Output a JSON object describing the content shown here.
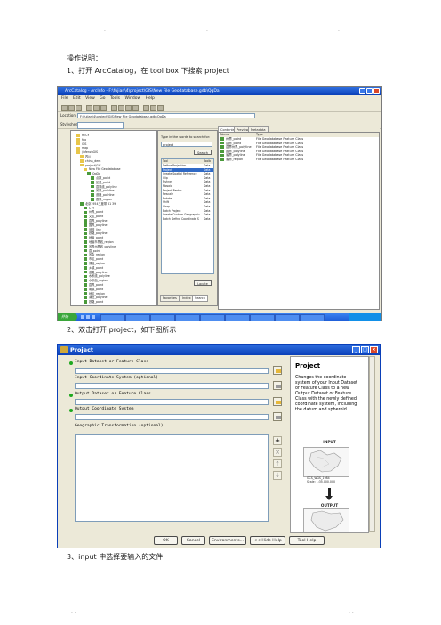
{
  "doc": {
    "header_marks": [
      ".",
      ".",
      "."
    ],
    "footer_marks": [
      ". .",
      ". ."
    ],
    "heading": "操作说明：",
    "step1": "1、打开 ArcCatalog，在 tool box 下搜索 project",
    "step2": "2、双击打开 project，如下图所示",
    "step3": "3、input 中选择要输入的文件"
  },
  "arccatalog": {
    "title": "ArcCatalog - ArcInfo - F:\\fujian\\4\\project\\GIS\\New File Geodatabase.gdb\\QgDa",
    "menu": [
      "File",
      "Edit",
      "View",
      "Go",
      "Tools",
      "Window",
      "Help"
    ],
    "location_label": "Location:",
    "location_value": "F:\\fujian\\4\\project\\GIS\\New File Geodatabase.gdb\\QgDa",
    "stylesheet_label": "Stylesheet:",
    "tree": [
      "RECY",
      "foo",
      "GIS",
      "map",
      "jiufenzhGIS",
      "四川",
      "china_dem",
      "project\\GIS",
      "New File Geodatabase",
      "QgDa",
      "点数_point",
      "区县_point",
      "县界线_polyline",
      "省界_polyline",
      "道路_polyline",
      "县界_region",
      "北京1954三度带 81 39",
      "CTY",
      "州界_point",
      "文区_point",
      "县界_polyline",
      "国界_polyline",
      "河流_line",
      "铁路_polyline",
      "地级_point",
      "地级市界线_region",
      "省界州界线_polyline",
      "县_point",
      "省会_region",
      "市区_point",
      "湖泊_region",
      "乡镇_point",
      "道路_polyline",
      "水系线_polyline",
      "水系面_region",
      "县界_point",
      "城镇_point",
      "地区_region",
      "湖泊_polyline",
      "铁路_point"
    ],
    "search_prompt": "Type in the words to search for:",
    "search_value": "project",
    "search_button": "Search",
    "tool_header": [
      "Tool",
      "Toolb"
    ],
    "tools": [
      [
        "Define Projection",
        "Data"
      ],
      [
        "Project",
        "Data"
      ],
      [
        "Create Spatial Reference",
        "Data"
      ],
      [
        "Clip",
        "Data"
      ],
      [
        "Fishnet",
        "Data"
      ],
      [
        "Mosaic",
        "Data"
      ],
      [
        "Project Raster",
        "Data"
      ],
      [
        "Rescale",
        "Data"
      ],
      [
        "Rotate",
        "Data"
      ],
      [
        "Shift",
        "Data"
      ],
      [
        "Warp",
        "Data"
      ],
      [
        "Batch Project",
        "Data"
      ],
      [
        "Create Custom Geographic",
        "Data"
      ],
      [
        "Batch Define Coordinate S",
        "Data"
      ]
    ],
    "locate_button": "Locate",
    "bottom_tabs": [
      "Favorites",
      "Index",
      "Search"
    ],
    "content_tabs": [
      "Contents",
      "Preview",
      "Metadata"
    ],
    "content_header": [
      "Name",
      "Type"
    ],
    "contents": [
      [
        "州界_point",
        "File Geodatabase Feature Class"
      ],
      [
        "县界_point",
        "File Geodatabase Feature Class"
      ],
      [
        "县界州界_polyline",
        "File Geodatabase Feature Class"
      ],
      [
        "国界_polyline",
        "File Geodatabase Feature Class"
      ],
      [
        "省界_polyline",
        "File Geodatabase Feature Class"
      ],
      [
        "省界_region",
        "File Geodatabase Feature Class"
      ]
    ],
    "start_label": "开始"
  },
  "project_dialog": {
    "title": "Project",
    "labels": {
      "input": "Input Dataset or Feature Class",
      "input_cs": "Input Coordinate System (optional)",
      "output": "Output Dataset or Feature Class",
      "output_cs": "Output Coordinate System",
      "geo_transform": "Geographic Transformation (optional)"
    },
    "help": {
      "title": "Project",
      "body": "Changes the coordinate system of your Input Dataset or Feature Class to a new Output Dataset or Feature Class with the newly defined coordinate system, including the datum and spheroid.",
      "input_label": "INPUT",
      "input_caption_1": "GCS_WGS_1984",
      "input_caption_2": "Scale: 1:35,000,000",
      "output_label": "OUTPUT"
    },
    "buttons": [
      "OK",
      "Cancel",
      "Environments...",
      "<< Hide Help",
      "Tool Help"
    ]
  },
  "colors": {
    "xp_blue": "#0a3fb8",
    "required_dot": "#1fa81f",
    "selection": "#316ac5"
  }
}
